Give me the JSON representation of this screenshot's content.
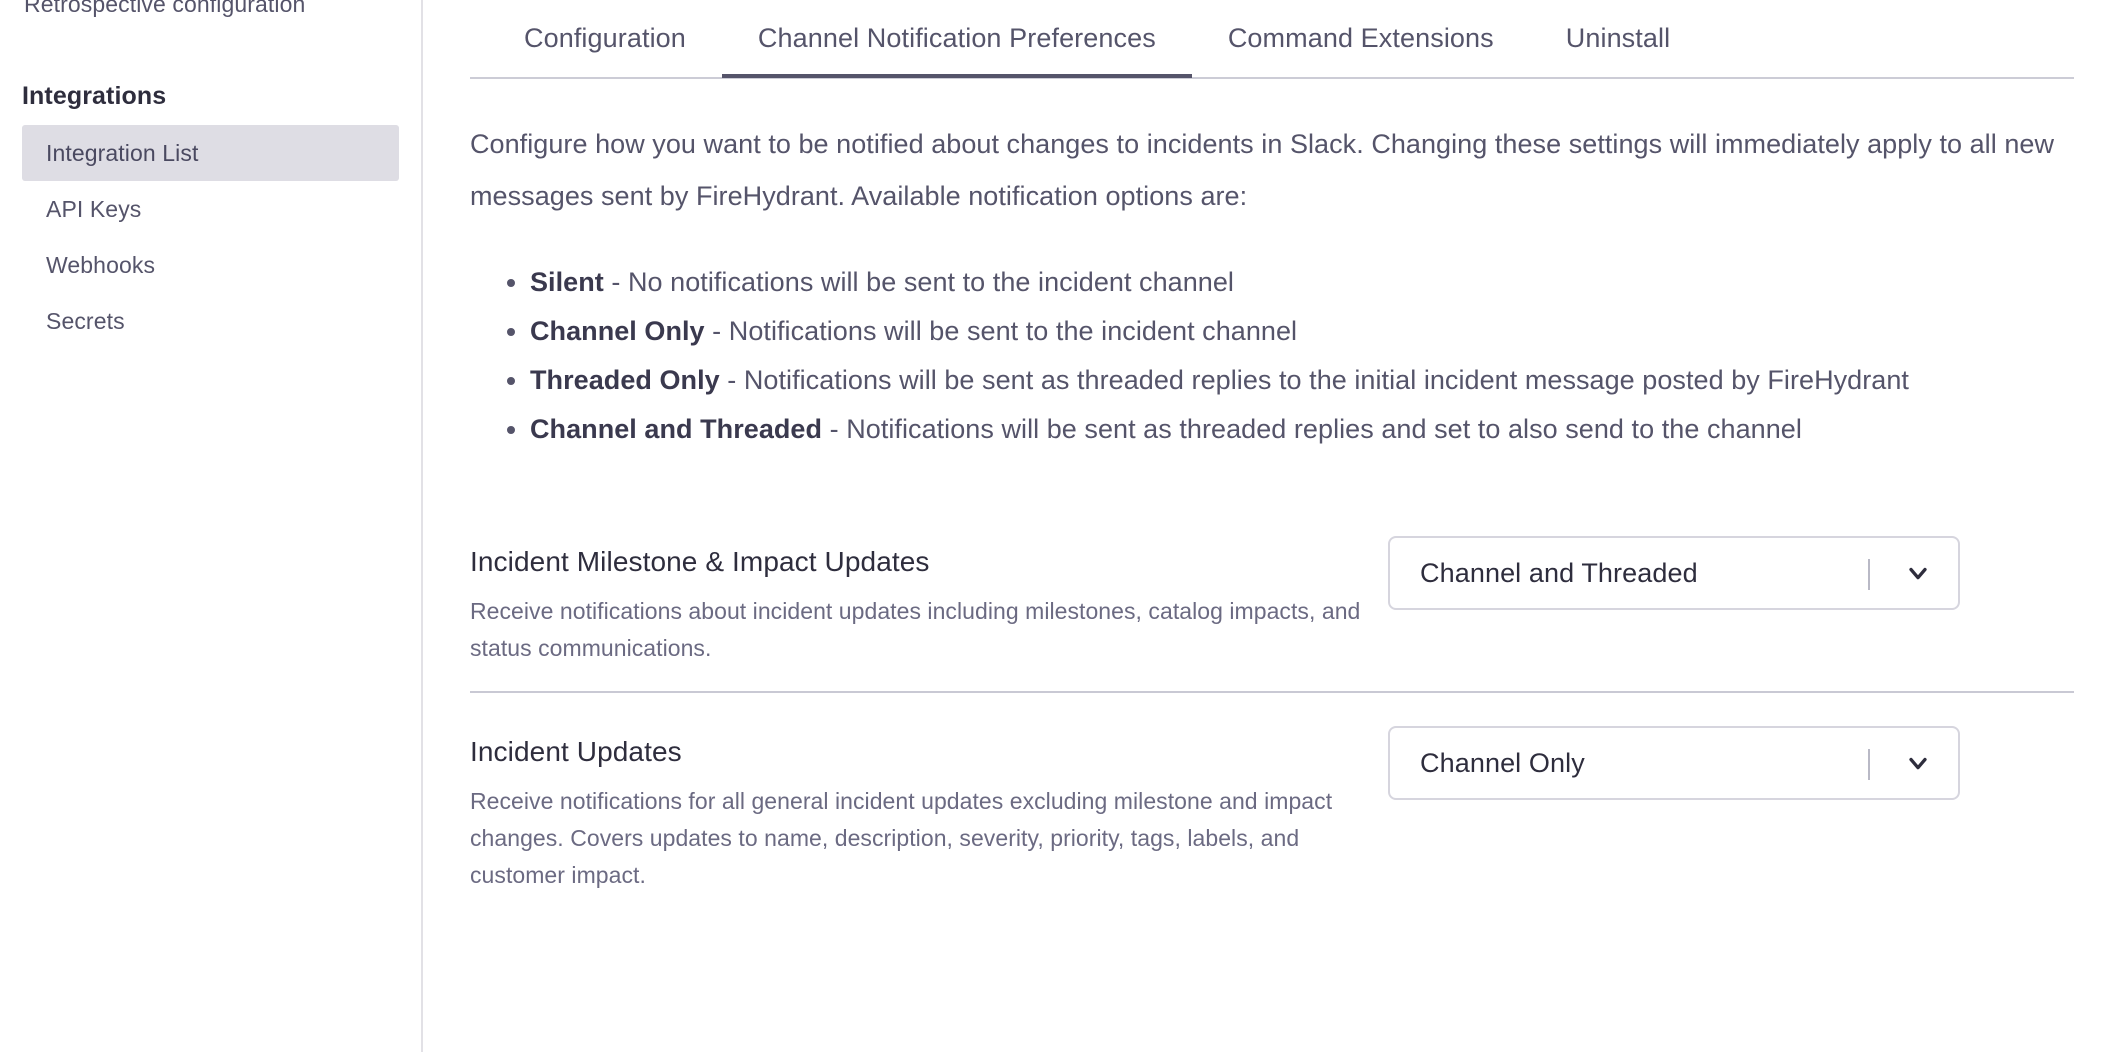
{
  "sidebar": {
    "clipped_item_above": "",
    "top_link": "Retrospective configuration",
    "section_title": "Integrations",
    "items": [
      {
        "label": "Integration List",
        "active": true
      },
      {
        "label": "API Keys",
        "active": false
      },
      {
        "label": "Webhooks",
        "active": false
      },
      {
        "label": "Secrets",
        "active": false
      }
    ]
  },
  "tabs": [
    {
      "label": "Configuration",
      "active": false
    },
    {
      "label": "Channel Notification Preferences",
      "active": true
    },
    {
      "label": "Command Extensions",
      "active": false
    },
    {
      "label": "Uninstall",
      "active": false
    }
  ],
  "main": {
    "intro": "Configure how you want to be notified about changes to incidents in Slack. Changing these settings will immediately apply to all new messages sent by FireHydrant. Available notification options are:",
    "options": [
      {
        "name": "Silent",
        "separator": " - ",
        "desc": "No notifications will be sent to the incident channel"
      },
      {
        "name": "Channel Only",
        "separator": " - ",
        "desc": "Notifications will be sent to the incident channel"
      },
      {
        "name": "Threaded Only",
        "separator": " - ",
        "desc": "Notifications will be sent as threaded replies to the initial incident message posted by FireHydrant"
      },
      {
        "name": "Channel and Threaded",
        "separator": " - ",
        "desc": "Notifications will be sent as threaded replies and set to also send to the channel"
      }
    ],
    "settings": [
      {
        "title": "Incident Milestone & Impact Updates",
        "description": "Receive notifications about incident updates including milestones, catalog impacts, and status communications.",
        "selected": "Channel and Threaded"
      },
      {
        "title": "Incident Updates",
        "description": "Receive notifications for all general incident updates excluding milestone and impact changes. Covers updates to name, description, severity, priority, tags, labels, and customer impact.",
        "selected": "Channel Only"
      }
    ]
  },
  "colors": {
    "text_primary": "#2e2d3d",
    "text_secondary": "#55546a",
    "text_muted": "#6b6a82",
    "active_nav_bg": "#dedde4",
    "border": "#d6d5de",
    "tab_underline": "#55546a"
  }
}
